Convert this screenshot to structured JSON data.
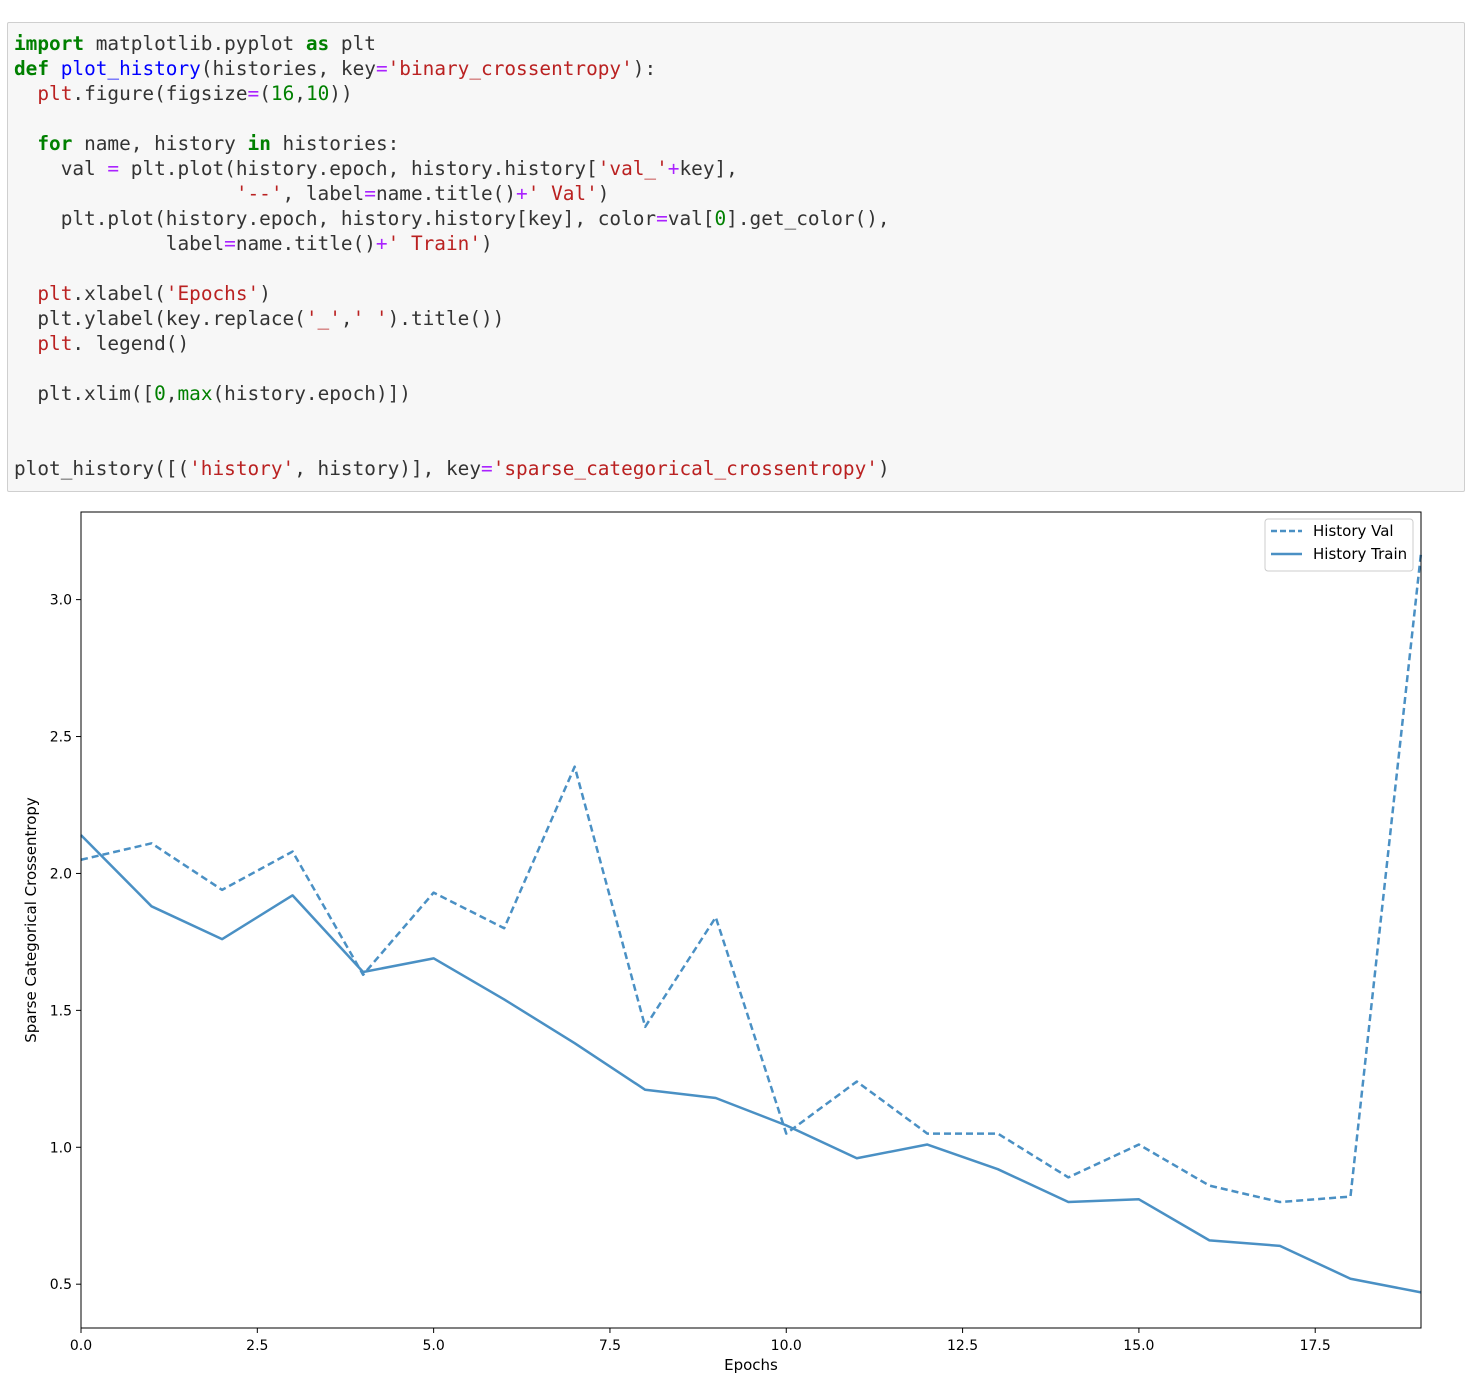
{
  "code_lines": [
    [
      {
        "t": "import",
        "c": "kw"
      },
      {
        "t": " matplotlib.pyplot ",
        "c": "p"
      },
      {
        "t": "as",
        "c": "kw"
      },
      {
        "t": " plt",
        "c": "p"
      }
    ],
    [
      {
        "t": "def",
        "c": "kw"
      },
      {
        "t": " ",
        "c": "p"
      },
      {
        "t": "plot_history",
        "c": "fn"
      },
      {
        "t": "(histories, key",
        "c": "p"
      },
      {
        "t": "=",
        "c": "op"
      },
      {
        "t": "'binary_crossentropy'",
        "c": "str"
      },
      {
        "t": "):",
        "c": "p"
      }
    ],
    [
      {
        "t": "  ",
        "c": "p"
      },
      {
        "t": "plt",
        "c": "mod"
      },
      {
        "t": ".figure(figsize",
        "c": "p"
      },
      {
        "t": "=",
        "c": "op"
      },
      {
        "t": "(",
        "c": "p"
      },
      {
        "t": "16",
        "c": "num"
      },
      {
        "t": ",",
        "c": "p"
      },
      {
        "t": "10",
        "c": "num"
      },
      {
        "t": "))",
        "c": "p"
      }
    ],
    [],
    [
      {
        "t": "  ",
        "c": "p"
      },
      {
        "t": "for",
        "c": "kw"
      },
      {
        "t": " name, history ",
        "c": "p"
      },
      {
        "t": "in",
        "c": "kw"
      },
      {
        "t": " histories:",
        "c": "p"
      }
    ],
    [
      {
        "t": "    val ",
        "c": "p"
      },
      {
        "t": "=",
        "c": "op"
      },
      {
        "t": " plt.plot(history.epoch, history.history[",
        "c": "p"
      },
      {
        "t": "'val_'",
        "c": "str"
      },
      {
        "t": "+",
        "c": "op"
      },
      {
        "t": "key],",
        "c": "p"
      }
    ],
    [
      {
        "t": "                   ",
        "c": "p"
      },
      {
        "t": "'--'",
        "c": "str"
      },
      {
        "t": ", label",
        "c": "p"
      },
      {
        "t": "=",
        "c": "op"
      },
      {
        "t": "name.title()",
        "c": "p"
      },
      {
        "t": "+",
        "c": "op"
      },
      {
        "t": "' Val'",
        "c": "str"
      },
      {
        "t": ")",
        "c": "p"
      }
    ],
    [
      {
        "t": "    plt.plot(history.epoch, history.history[key], color",
        "c": "p"
      },
      {
        "t": "=",
        "c": "op"
      },
      {
        "t": "val[",
        "c": "p"
      },
      {
        "t": "0",
        "c": "num"
      },
      {
        "t": "].get_color(),",
        "c": "p"
      }
    ],
    [
      {
        "t": "             label",
        "c": "p"
      },
      {
        "t": "=",
        "c": "op"
      },
      {
        "t": "name.title()",
        "c": "p"
      },
      {
        "t": "+",
        "c": "op"
      },
      {
        "t": "' Train'",
        "c": "str"
      },
      {
        "t": ")",
        "c": "p"
      }
    ],
    [],
    [
      {
        "t": "  ",
        "c": "p"
      },
      {
        "t": "plt",
        "c": "mod"
      },
      {
        "t": ".xlabel(",
        "c": "p"
      },
      {
        "t": "'Epochs'",
        "c": "str"
      },
      {
        "t": ")",
        "c": "p"
      }
    ],
    [
      {
        "t": "  plt.ylabel(key.replace(",
        "c": "p"
      },
      {
        "t": "'_'",
        "c": "str"
      },
      {
        "t": ",",
        "c": "p"
      },
      {
        "t": "' '",
        "c": "str"
      },
      {
        "t": ").title())",
        "c": "p"
      }
    ],
    [
      {
        "t": "  ",
        "c": "p"
      },
      {
        "t": "plt",
        "c": "mod"
      },
      {
        "t": ". legend()",
        "c": "p"
      }
    ],
    [],
    [
      {
        "t": "  plt.xlim([",
        "c": "p"
      },
      {
        "t": "0",
        "c": "num"
      },
      {
        "t": ",",
        "c": "p"
      },
      {
        "t": "max",
        "c": "bi"
      },
      {
        "t": "(history.epoch)])",
        "c": "p"
      }
    ],
    [],
    [],
    [
      {
        "t": "plot_history([(",
        "c": "p"
      },
      {
        "t": "'history'",
        "c": "str"
      },
      {
        "t": ", history)], key",
        "c": "p"
      },
      {
        "t": "=",
        "c": "op"
      },
      {
        "t": "'sparse_categorical_crossentropy'",
        "c": "str"
      },
      {
        "t": ")",
        "c": "p"
      }
    ]
  ],
  "chart_data": {
    "type": "line",
    "xlabel": "Epochs",
    "ylabel": "Sparse Categorical Crossentropy",
    "xlim": [
      0,
      19
    ],
    "ylim": [
      0.34,
      3.32
    ],
    "xticks": [
      0,
      2.5,
      5,
      7.5,
      10,
      12.5,
      15,
      17.5
    ],
    "xtick_labels": [
      "0.0",
      "2.5",
      "5.0",
      "7.5",
      "10.0",
      "12.5",
      "15.0",
      "17.5"
    ],
    "yticks": [
      0.5,
      1.0,
      1.5,
      2.0,
      2.5,
      3.0
    ],
    "ytick_labels": [
      "0.5",
      "1.0",
      "1.5",
      "2.0",
      "2.5",
      "3.0"
    ],
    "legend_position": "top-right",
    "color": "#4a90c4",
    "series": [
      {
        "name": "History Val",
        "style": "dashed",
        "x": [
          0,
          1,
          2,
          3,
          4,
          5,
          6,
          7,
          8,
          9,
          10,
          11,
          12,
          13,
          14,
          15,
          16,
          17,
          18,
          19
        ],
        "values": [
          2.05,
          2.11,
          1.94,
          2.08,
          1.63,
          1.93,
          1.8,
          2.39,
          1.44,
          1.84,
          1.05,
          1.24,
          1.05,
          1.05,
          0.89,
          1.01,
          0.86,
          0.8,
          0.82,
          3.17
        ]
      },
      {
        "name": "History Train",
        "style": "solid",
        "x": [
          0,
          1,
          2,
          3,
          4,
          5,
          6,
          7,
          8,
          9,
          10,
          11,
          12,
          13,
          14,
          15,
          16,
          17,
          18,
          19
        ],
        "values": [
          2.14,
          1.88,
          1.76,
          1.92,
          1.64,
          1.69,
          1.54,
          1.38,
          1.21,
          1.18,
          1.08,
          0.96,
          1.01,
          0.92,
          0.8,
          0.81,
          0.66,
          0.64,
          0.52,
          0.47
        ]
      }
    ]
  }
}
